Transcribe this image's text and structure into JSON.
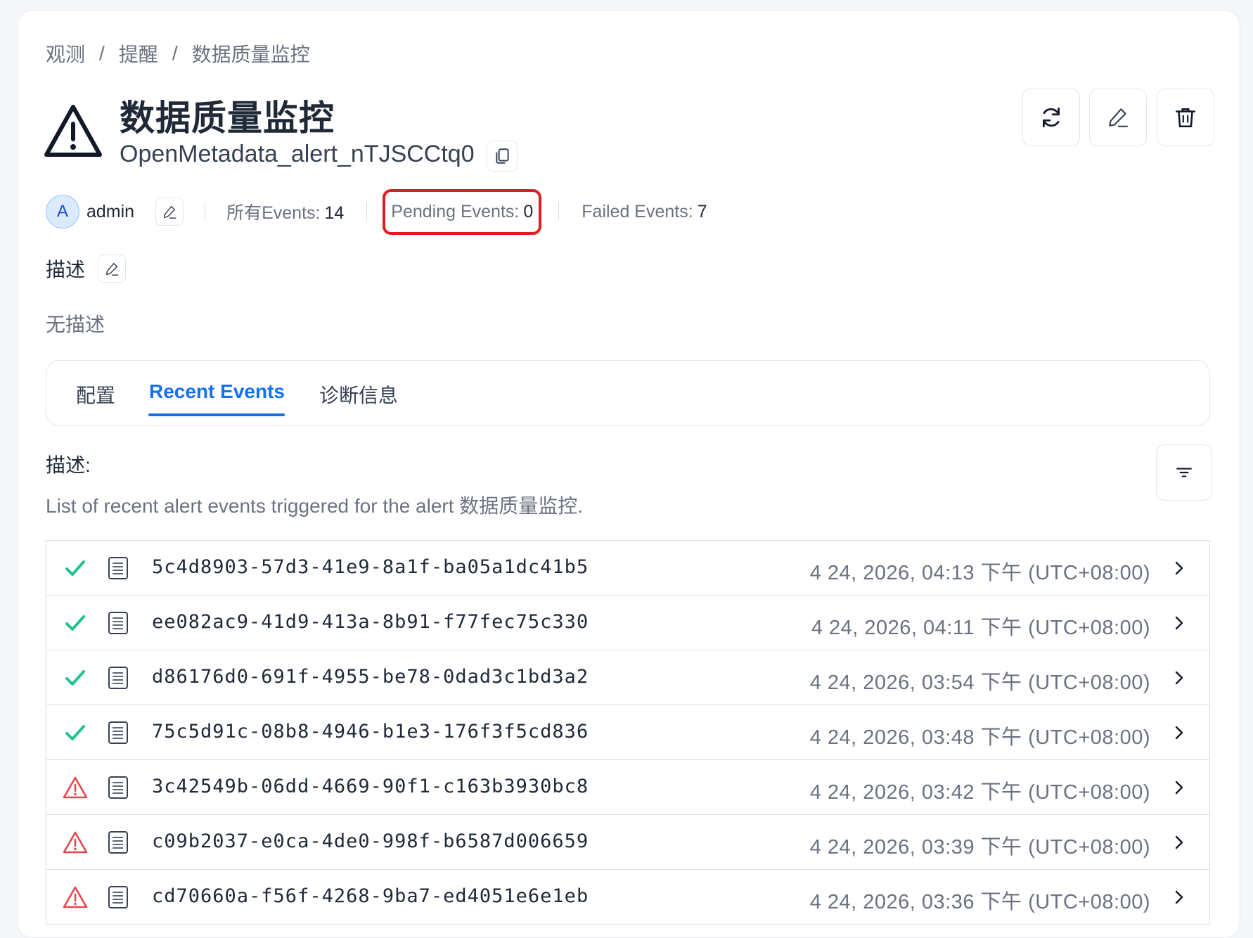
{
  "breadcrumb": {
    "items": [
      "观测",
      "提醒",
      "数据质量监控"
    ],
    "separator": "/"
  },
  "header": {
    "title": "数据质量监控",
    "fqn": "OpenMetadata_alert_nTJSCCtq0",
    "actions": {
      "refresh_icon": "refresh-icon",
      "edit_icon": "pencil-icon",
      "delete_icon": "trash-icon"
    }
  },
  "meta": {
    "owner_initial": "A",
    "owner_name": "admin",
    "all_events_label": "所有Events:",
    "all_events_value": "14",
    "pending_events_label": "Pending Events:",
    "pending_events_value": "0",
    "failed_events_label": "Failed Events:",
    "failed_events_value": "7"
  },
  "description": {
    "title": "描述",
    "empty_text": "无描述"
  },
  "tabs": [
    {
      "label": "配置"
    },
    {
      "label": "Recent Events",
      "active": true
    },
    {
      "label": "诊断信息"
    }
  ],
  "recent_events": {
    "desc_label": "描述:",
    "desc_text": "List of recent alert events triggered for the alert 数据质量监控.",
    "events": [
      {
        "status": "success",
        "id": "5c4d8903-57d3-41e9-8a1f-ba05a1dc41b5",
        "timestamp": "4 24, 2026, 04:13 下午 (UTC+08:00)"
      },
      {
        "status": "success",
        "id": "ee082ac9-41d9-413a-8b91-f77fec75c330",
        "timestamp": "4 24, 2026, 04:11 下午 (UTC+08:00)"
      },
      {
        "status": "success",
        "id": "d86176d0-691f-4955-be78-0dad3c1bd3a2",
        "timestamp": "4 24, 2026, 03:54 下午 (UTC+08:00)"
      },
      {
        "status": "success",
        "id": "75c5d91c-08b8-4946-b1e3-176f3f5cd836",
        "timestamp": "4 24, 2026, 03:48 下午 (UTC+08:00)"
      },
      {
        "status": "failed",
        "id": "3c42549b-06dd-4669-90f1-c163b3930bc8",
        "timestamp": "4 24, 2026, 03:42 下午 (UTC+08:00)"
      },
      {
        "status": "failed",
        "id": "c09b2037-e0ca-4de0-998f-b6587d006659",
        "timestamp": "4 24, 2026, 03:39 下午 (UTC+08:00)"
      },
      {
        "status": "failed",
        "id": "cd70660a-f56f-4268-9ba7-ed4051e6e1eb",
        "timestamp": "4 24, 2026, 03:36 下午 (UTC+08:00)"
      }
    ]
  },
  "colors": {
    "accent": "#1570ef",
    "success": "#22c38e",
    "failed": "#e5484d",
    "highlight_box": "#e11d24"
  }
}
